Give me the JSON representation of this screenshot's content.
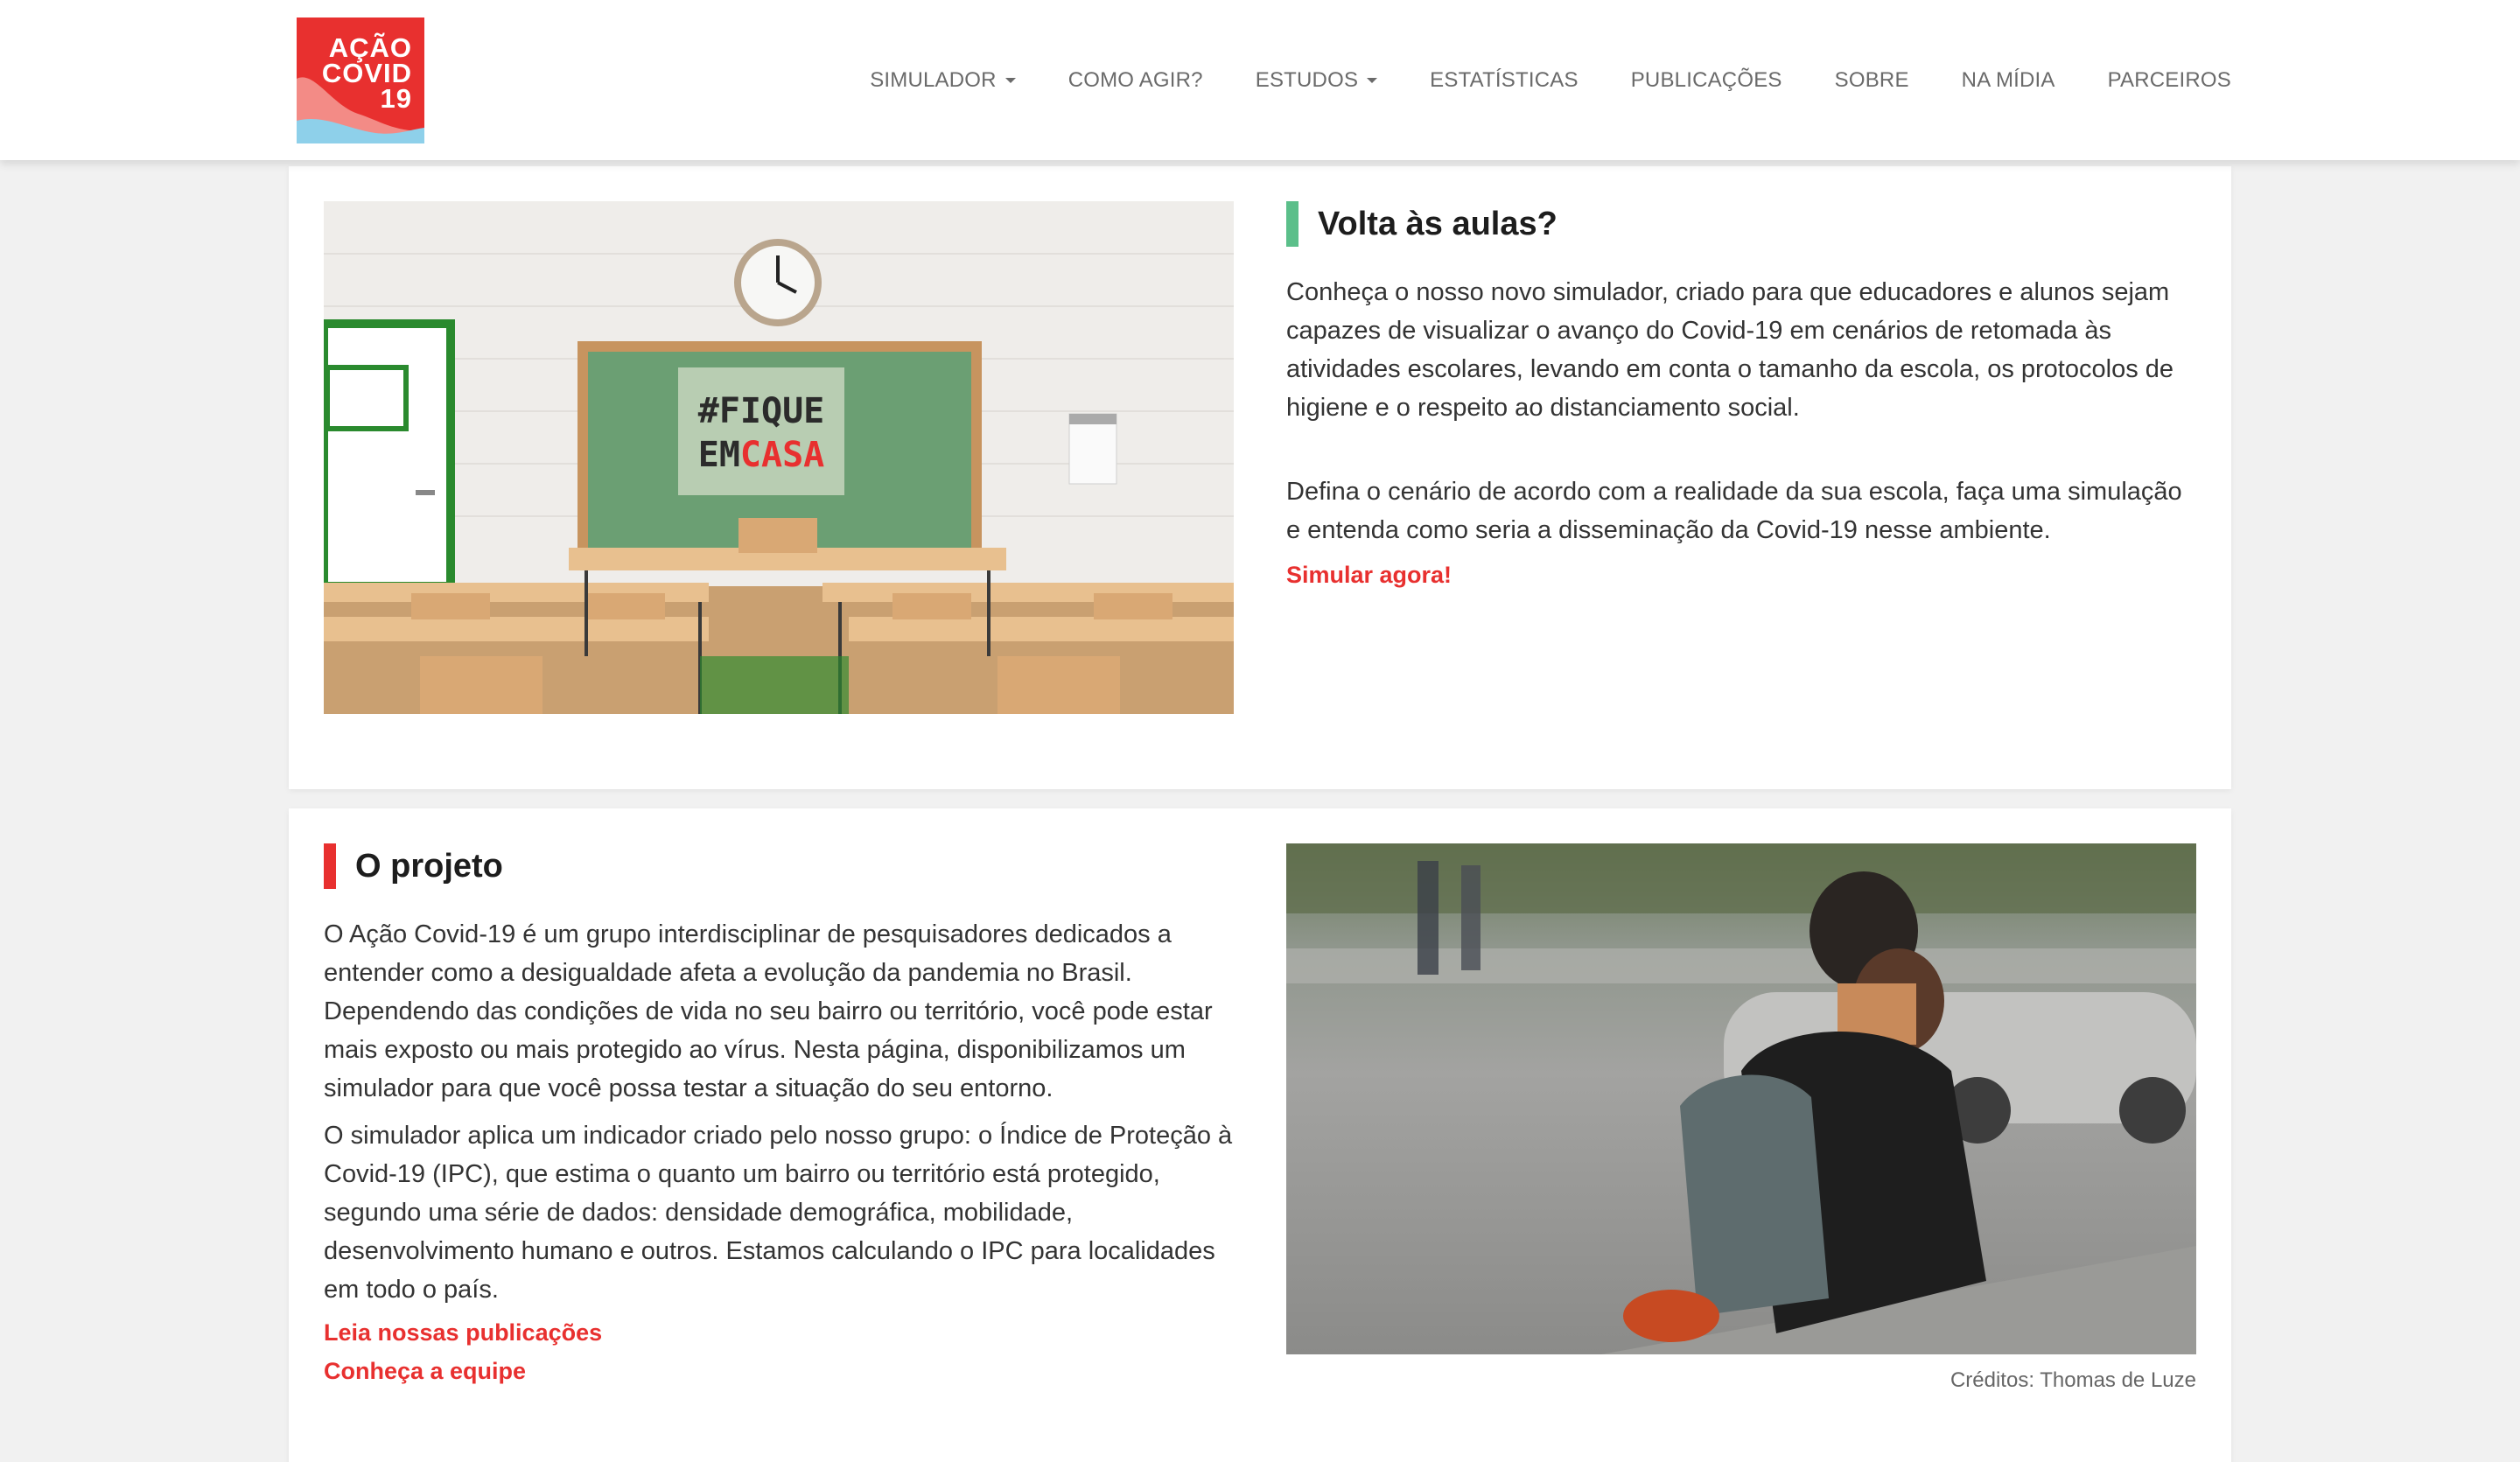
{
  "brand": {
    "logo_lines": [
      "AÇÃO",
      "COVID",
      "19"
    ],
    "color": "#e8302f"
  },
  "nav": {
    "items": [
      {
        "label": "SIMULADOR",
        "dropdown": true
      },
      {
        "label": "COMO AGIR?",
        "dropdown": false
      },
      {
        "label": "ESTUDOS",
        "dropdown": true
      },
      {
        "label": "ESTATÍSTICAS",
        "dropdown": false
      },
      {
        "label": "PUBLICAÇÕES",
        "dropdown": false
      },
      {
        "label": "SOBRE",
        "dropdown": false
      },
      {
        "label": "NA MÍDIA",
        "dropdown": false
      },
      {
        "label": "PARCEIROS",
        "dropdown": false
      }
    ]
  },
  "back_to_school": {
    "title": "Volta às aulas?",
    "accent": "#5bbf8a",
    "paragraph_1": "Conheça o nosso novo simulador, criado para que educadores e alunos sejam capazes de visualizar o avanço do Covid-19 em cenários de retomada às atividades escolares, levando em conta o tamanho da escola, os protocolos de higiene e o respeito ao distanciamento social.",
    "paragraph_2": "Defina o cenário de acordo com a realidade da sua escola, faça uma simulação e entenda como seria a disseminação da Covid-19 nesse ambiente.",
    "cta": "Simular agora!",
    "image": {
      "board_line_1": "#FIQUE",
      "board_line_2_a": "EM",
      "board_line_2_b": "CASA"
    }
  },
  "project": {
    "title": "O projeto",
    "accent": "#e8302f",
    "paragraph_1": "O Ação Covid-19 é um grupo interdisciplinar de pesquisadores dedicados a entender como a desigualdade afeta a evolução da pandemia no Brasil. Dependendo das condições de vida no seu bairro ou território, você pode estar mais exposto ou mais protegido ao vírus. Nesta página, disponibilizamos um simulador para que você possa testar a situação do seu entorno.",
    "paragraph_2": "O simulador aplica um indicador criado pelo nosso grupo: o Índice de Proteção à Covid-19 (IPC), que estima o quanto um bairro ou território está protegido, segundo uma série de dados: densidade demográfica, mobilidade, desenvolvimento humano e outros. Estamos calculando o IPC para localidades em todo o país.",
    "link_publications": "Leia nossas publicações",
    "link_team": "Conheça a equipe",
    "photo_credit": "Créditos: Thomas de Luze"
  }
}
